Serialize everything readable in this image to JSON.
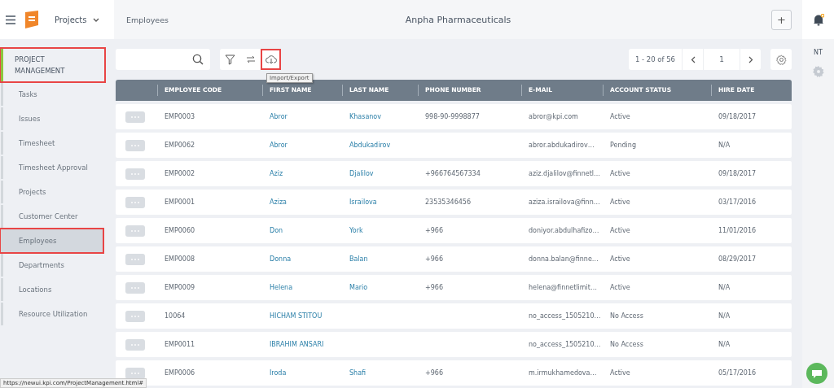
{
  "top_bar": {
    "module": "Projects",
    "breadcrumb": "Employees",
    "company": "Anpha Pharmaceuticals",
    "add_label": "+",
    "notification_unread": true
  },
  "sidebar": {
    "section": {
      "label": "PROJECT MANAGEMENT",
      "highlighted": true
    },
    "items": [
      {
        "label": "Tasks",
        "selected": false,
        "highlighted": false
      },
      {
        "label": "Issues",
        "selected": false,
        "highlighted": false
      },
      {
        "label": "Timesheet",
        "selected": false,
        "highlighted": false
      },
      {
        "label": "Timesheet Approval",
        "selected": false,
        "highlighted": false
      },
      {
        "label": "Projects",
        "selected": false,
        "highlighted": false
      },
      {
        "label": "Customer Center",
        "selected": false,
        "highlighted": false
      },
      {
        "label": "Employees",
        "selected": true,
        "highlighted": true
      },
      {
        "label": "Departments",
        "selected": false,
        "highlighted": false
      },
      {
        "label": "Locations",
        "selected": false,
        "highlighted": false
      },
      {
        "label": "Resource Utilization",
        "selected": false,
        "highlighted": false
      }
    ]
  },
  "toolbar": {
    "import_export": {
      "highlighted": true,
      "tooltip": "Import/Export"
    },
    "pagination": {
      "range": "1 - 20 of 56",
      "page": "1"
    }
  },
  "table": {
    "columns": [
      "EMPLOYEE CODE",
      "FIRST NAME",
      "LAST NAME",
      "PHONE NUMBER",
      "E-MAIL",
      "ACCOUNT STATUS",
      "HIRE DATE"
    ],
    "rows": [
      [
        "EMP0003",
        "Abror",
        "Khasanov",
        "998-90-9998877",
        "abror@kpi.com",
        "Active",
        "09/18/2017"
      ],
      [
        "EMP0062",
        "Abror",
        "Abdukadirov",
        "",
        "abror.abdukadirov…",
        "Pending",
        "N/A"
      ],
      [
        "EMP0002",
        "Aziz",
        "Djalilov",
        "+966764567334",
        "aziz.djalilov@finnetl…",
        "Active",
        "09/18/2017"
      ],
      [
        "EMP0001",
        "Aziza",
        "Israilova",
        "23535346456",
        "aziza.israilova@finn…",
        "Active",
        "03/17/2016"
      ],
      [
        "EMP0060",
        "Don",
        "York",
        "+966",
        "doniyor.abdulhafizo…",
        "Active",
        "11/01/2016"
      ],
      [
        "EMP0008",
        "Donna",
        "Balan",
        "+966",
        "donna.balan@finne…",
        "Active",
        "08/29/2017"
      ],
      [
        "EMP0009",
        "Helena",
        "Mario",
        "+966",
        "helena@finnetlimit…",
        "Active",
        "N/A"
      ],
      [
        "10064",
        "HICHAM STITOU",
        "",
        "",
        "no_access_1505210…",
        "No Access",
        "N/A"
      ],
      [
        "EMP0011",
        "IBRAHIM ANSARI",
        "",
        "",
        "no_access_1505210…",
        "No Access",
        "N/A"
      ],
      [
        "EMP0006",
        "Iroda",
        "Shafi",
        "+966",
        "m.irmukhamedova…",
        "Active",
        "05/17/2016"
      ]
    ]
  },
  "right_rail": {
    "initials": "NT"
  },
  "status_bar": {
    "url": "https://newui.kpi.com/ProjectManagement.html#"
  }
}
